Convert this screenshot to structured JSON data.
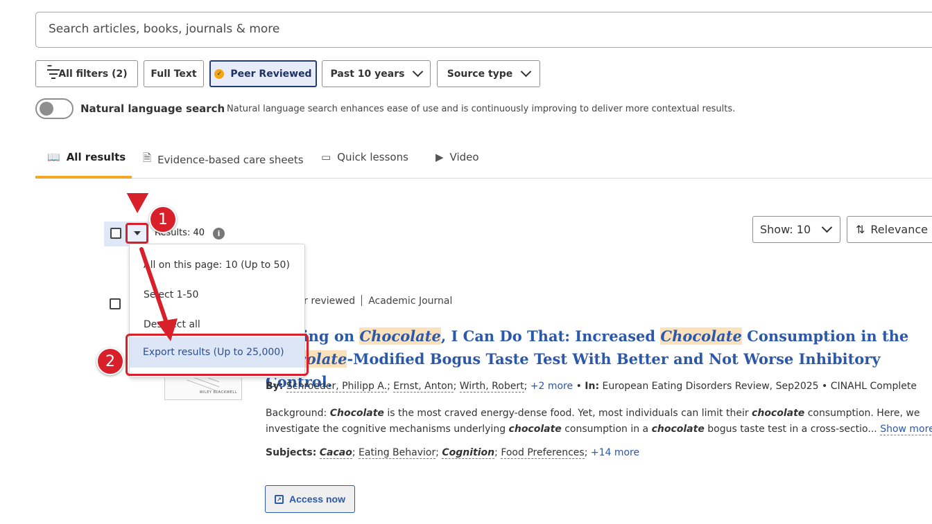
{
  "search": {
    "placeholder": "Search articles, books, journals & more"
  },
  "filters": {
    "all_filters": "All filters (2)",
    "full_text": "Full Text",
    "peer_reviewed": "Peer Reviewed",
    "past_years": "Past 10 years",
    "source_type": "Source type"
  },
  "nls": {
    "label": "Natural language search",
    "description": "Natural language search enhances ease of use and is continuously improving to deliver more contextual results."
  },
  "tabs": {
    "all_results": "All results",
    "care_sheets": "Evidence-based care sheets",
    "quick_lessons": "Quick lessons",
    "video": "Video"
  },
  "results": {
    "count": "Results: 40",
    "show": "Show: 10",
    "sort": "Relevance"
  },
  "dropdown": {
    "all_page": "All on this page: 10 (Up to 50)",
    "select_range": "Select 1-50",
    "deselect": "Deselect all",
    "export": "Export results (Up to 25,000)"
  },
  "annotations": {
    "step1": "1",
    "step2": "2"
  },
  "article": {
    "meta_reviewed": "Peer reviewed",
    "meta_type": "Academic Journal",
    "title_pre": "Craving on ",
    "title_hl1": "Chocolate",
    "title_mid1": ", I Can Do That: Increased ",
    "title_hl2": "Chocolate",
    "title_mid2": " Consumption in the ",
    "title_hl3": "Chocolate",
    "title_post": "-Modified Bogus Taste Test With Better and Not Worse Inhibitory Control.",
    "thumb_pub": "WILEY BLACKWELL",
    "by_label": "By:",
    "authors": [
      "Schroeder, Philipp A.",
      "Ernst, Anton",
      "Wirth, Robert"
    ],
    "more_authors": "+2 more",
    "in_label": "In:",
    "source": "European Eating Disorders Review, Sep2025",
    "database": "CINAHL Complete",
    "abstract": {
      "a1": "Background: ",
      "b1": "Chocolate",
      "a2": " is the most craved energy-dense food. Yet, most individuals can limit their ",
      "b2": "chocolate",
      "a3": " consumption. Here, we",
      "a4": "investigate the cognitive mechanisms underlying ",
      "b3": "chocolate",
      "a5": " consumption in a ",
      "b4": "chocolate",
      "a6": " bogus taste test in a cross-sectio",
      "ellipsis": "...",
      "show_more": "Show more"
    },
    "subjects_label": "Subjects:",
    "subjects": [
      "Cacao",
      "Eating Behavior",
      "Cognition",
      "Food Preferences"
    ],
    "more_subjects": "+14 more",
    "access": "Access now"
  },
  "colors": {
    "accent": "#f5a623",
    "link": "#2b58a8",
    "annotation": "#d8202a"
  }
}
